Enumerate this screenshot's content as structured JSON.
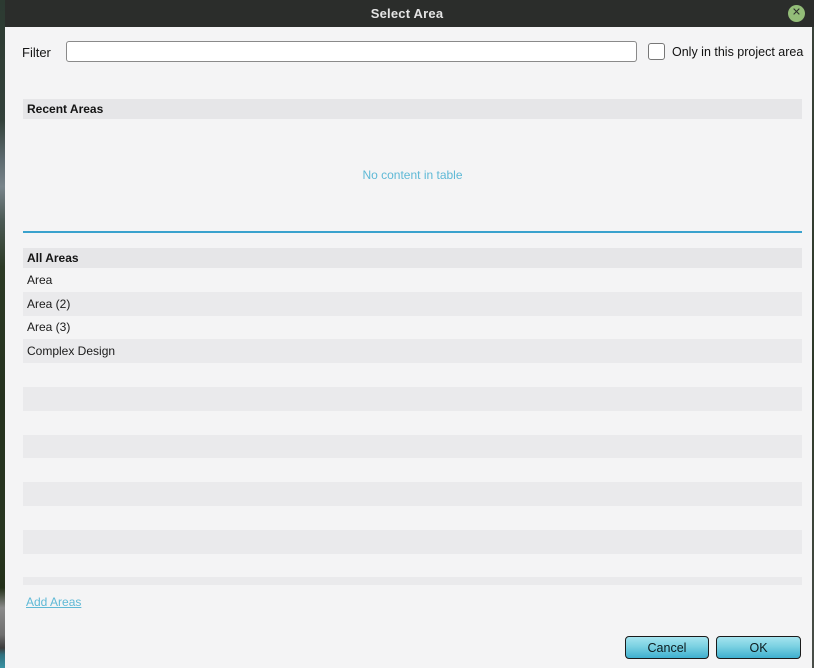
{
  "window": {
    "title": "Select Area",
    "close_icon": "✕"
  },
  "filter": {
    "label": "Filter",
    "value": "",
    "placeholder": ""
  },
  "project_checkbox": {
    "label": "Only in this project area",
    "checked": false
  },
  "recent_areas": {
    "header": "Recent Areas",
    "empty_text": "No content in table"
  },
  "all_areas": {
    "header": "All Areas",
    "rows": [
      "Area",
      "Area (2)",
      "Area (3)",
      "Complex Design",
      "",
      "",
      "",
      "",
      "",
      "",
      "",
      "",
      "",
      ""
    ]
  },
  "footer": {
    "add_areas_label": "Add Areas",
    "cancel_label": "Cancel",
    "ok_label": "OK"
  },
  "colors": {
    "titlebar": "#2b2d2b",
    "close_green": "#93bd78",
    "accent_blue": "#3aa2cd",
    "link": "#5fb9d6",
    "button_top": "#a5e4ef",
    "button_bottom": "#3fb0cf"
  }
}
